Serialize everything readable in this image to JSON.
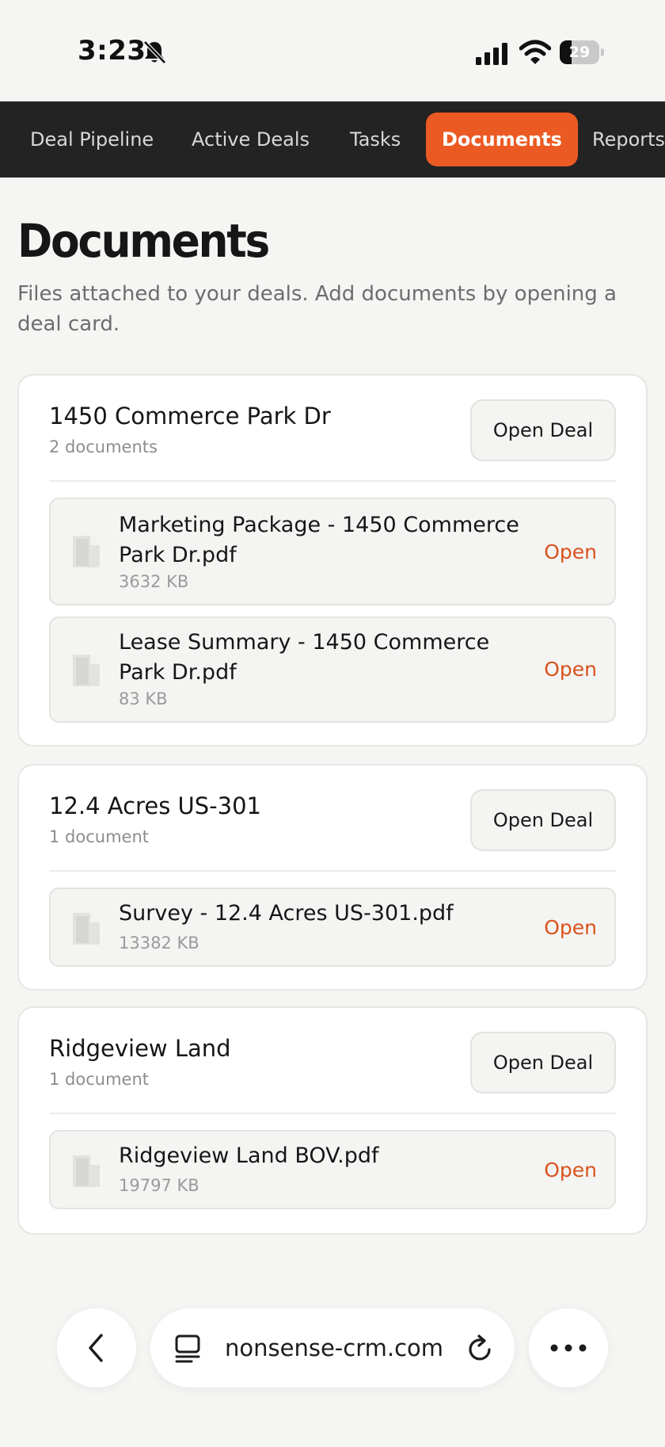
{
  "status_bar": {
    "time": "3:23",
    "battery_level": "29"
  },
  "nav": {
    "tabs": [
      {
        "label": "Deal Pipeline",
        "active": false
      },
      {
        "label": "Active Deals",
        "active": false
      },
      {
        "label": "Tasks",
        "active": false
      },
      {
        "label": "Documents",
        "active": true
      },
      {
        "label": "Reports",
        "active": false
      }
    ]
  },
  "page": {
    "title": "Documents",
    "subtitle": "Files attached to your deals. Add documents by opening a deal card."
  },
  "deals": [
    {
      "name": "1450 Commerce Park Dr",
      "count": "2 documents",
      "open_label": "Open Deal",
      "documents": [
        {
          "name": "Marketing Package - 1450 Commerce Park Dr.pdf",
          "size": "3632 KB",
          "open_label": "Open"
        },
        {
          "name": "Lease Summary - 1450 Commerce Park Dr.pdf",
          "size": "83 KB",
          "open_label": "Open"
        }
      ]
    },
    {
      "name": "12.4 Acres US-301",
      "count": "1 document",
      "open_label": "Open Deal",
      "documents": [
        {
          "name": "Survey - 12.4 Acres US-301.pdf",
          "size": "13382 KB",
          "open_label": "Open"
        }
      ]
    },
    {
      "name": "Ridgeview Land",
      "count": "1 document",
      "open_label": "Open Deal",
      "documents": [
        {
          "name": "Ridgeview Land BOV.pdf",
          "size": "19797 KB",
          "open_label": "Open"
        }
      ]
    }
  ],
  "browser": {
    "url": "nonsense-crm.com"
  },
  "colors": {
    "accent": "#ec5a24",
    "link": "#d9531e",
    "nav_background": "#232323"
  }
}
